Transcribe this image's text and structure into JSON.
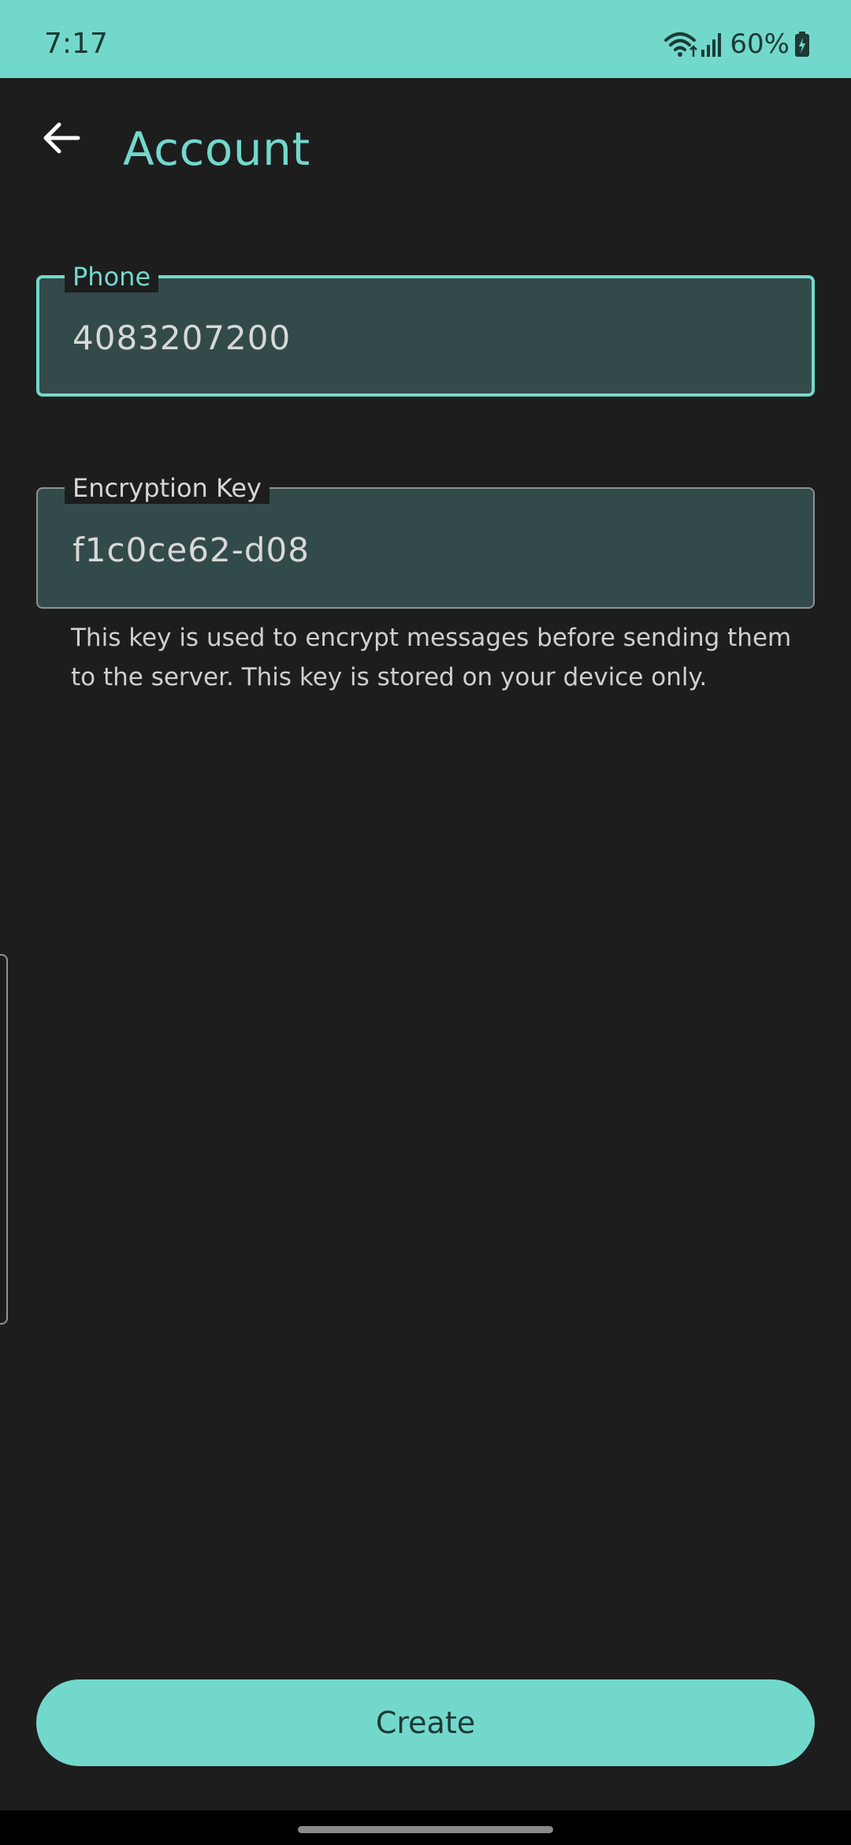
{
  "status_bar": {
    "time": "7:17",
    "battery": "60%",
    "icons": [
      "wifi-icon",
      "signal-icon",
      "battery-icon"
    ]
  },
  "app_bar": {
    "back_icon": "arrow-left-icon",
    "title": "Account"
  },
  "form": {
    "phone": {
      "label": "Phone",
      "value": "4083207200",
      "focused": true
    },
    "encryption_key": {
      "label": "Encryption Key",
      "value": "f1c0ce62-d08",
      "helper": "This key is used to encrypt messages before sending them to the server. This key is stored on your device only."
    }
  },
  "actions": {
    "create_label": "Create"
  },
  "colors": {
    "accent": "#73d8cc",
    "background": "#1d1d1e",
    "field_fill": "#334a4a",
    "text": "#d6d6d6"
  }
}
